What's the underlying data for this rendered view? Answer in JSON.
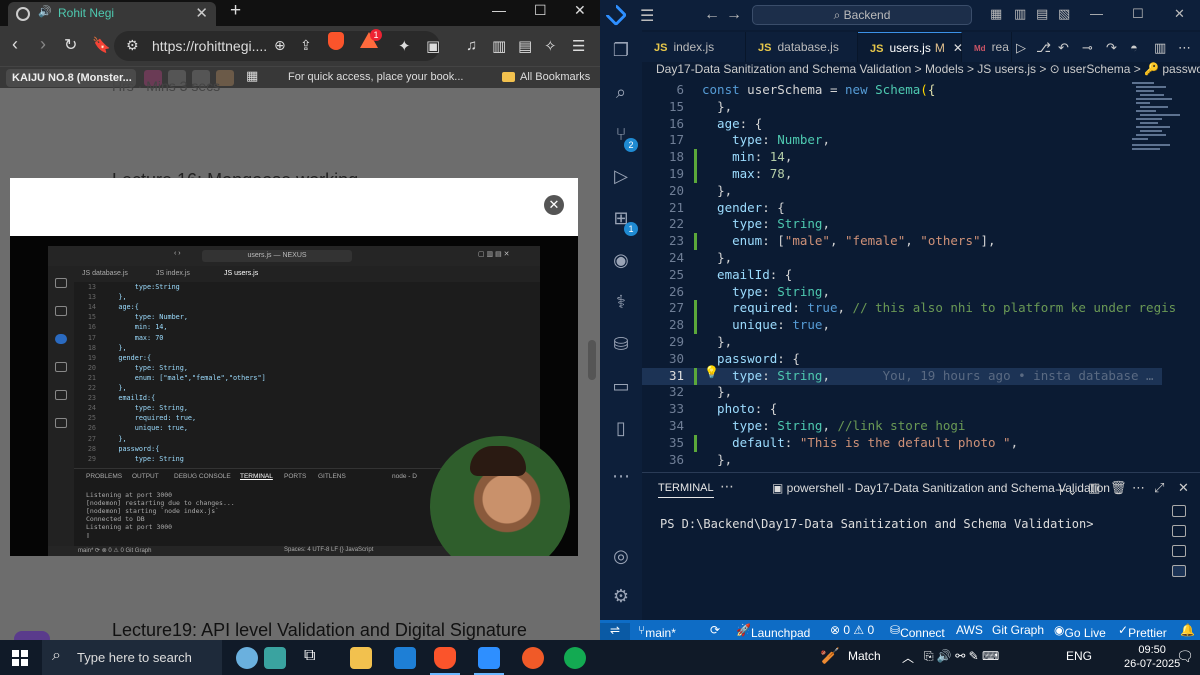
{
  "browser": {
    "tab_title": "Rohit Negi",
    "tab_close": "✕",
    "new_tab": "+",
    "url": "https://rohittnegi....",
    "brave_badge": "1",
    "bookmarks": {
      "first": "KAIJU NO.8 (Monster...",
      "hint": "For quick access, place your book...",
      "all": "All Bookmarks"
    },
    "page": {
      "top_partial": "Hrs · Mins 3 secs",
      "lecture16": "Lecture 16: Mongoose working",
      "lecture19": "Lecture19: API level Validation and Digital Signature",
      "modal_close": "✕"
    },
    "video": {
      "search": "users.js — NEXUS",
      "tabs": [
        "JS database.js",
        "JS index.js",
        "JS users.js"
      ],
      "code_lines": [
        {
          "n": "13",
          "t": "        type:String"
        },
        {
          "n": "13",
          "t": "    },"
        },
        {
          "n": "14",
          "t": "    age:{"
        },
        {
          "n": "15",
          "t": "        type: Number,"
        },
        {
          "n": "16",
          "t": "        min: 14,"
        },
        {
          "n": "17",
          "t": "        max: 70"
        },
        {
          "n": "18",
          "t": "    },"
        },
        {
          "n": "19",
          "t": "    gender:{"
        },
        {
          "n": "20",
          "t": "        type: String,"
        },
        {
          "n": "21",
          "t": "        enum: [\"male\",\"female\",\"others\"]"
        },
        {
          "n": "22",
          "t": "    },"
        },
        {
          "n": "23",
          "t": "    emailId:{"
        },
        {
          "n": "24",
          "t": "        type: String,"
        },
        {
          "n": "25",
          "t": "        required: true,"
        },
        {
          "n": "26",
          "t": "        unique: true,"
        },
        {
          "n": "27",
          "t": "    },"
        },
        {
          "n": "28",
          "t": "    password:{"
        },
        {
          "n": "29",
          "t": "        type: String"
        }
      ],
      "panel_tabs": [
        "PROBLEMS",
        "OUTPUT",
        "DEBUG CONSOLE",
        "TERMINAL",
        "PORTS",
        "GITLENS"
      ],
      "panel_node": "node - D",
      "terminal": "Listening at port 3000\n[nodemon] restarting due to changes...\n[nodemon] starting `node index.js`\nConnected to DB\nListening at port 3000\n▯",
      "status_left": "main*  ⟳  ⊗ 0 ⚠ 0  Git Graph",
      "status_right": "Spaces: 4   UTF-8   LF   {} JavaScript"
    }
  },
  "vscode": {
    "search": "Backend",
    "tabs": [
      {
        "label": "index.js",
        "type": "JS"
      },
      {
        "label": "database.js",
        "type": "JS"
      },
      {
        "label": "users.js",
        "type": "JS",
        "modified": "M",
        "close": "✕"
      },
      {
        "label": "rea",
        "type": "Md"
      }
    ],
    "breadcrumb": "Day17-Data Sanitization and Schema Validation  >  Models  >  JS  users.js  >  ⊙ userSchema  >  🔑 password",
    "code": [
      {
        "n": "6",
        "html": "<span class='k'>const</span> <span class='p'>userSchema</span> <span class='p'>=</span> <span class='k'>new</span> <span class='t'>Schema</span><span class='br'>(</span><span class='f'>{</span>"
      },
      {
        "n": "15",
        "html": "  <span class='p'>},</span>"
      },
      {
        "n": "16",
        "html": "  age<span class='p'>: {</span>"
      },
      {
        "n": "17",
        "html": "    type<span class='p'>:</span> <span class='t'>Number</span><span class='p'>,</span>"
      },
      {
        "n": "18",
        "html": "    min<span class='p'>:</span> <span class='n'>14</span><span class='p'>,</span>"
      },
      {
        "n": "19",
        "html": "    max<span class='p'>:</span> <span class='n'>78</span><span class='p'>,</span>"
      },
      {
        "n": "20",
        "html": "  <span class='p'>},</span>"
      },
      {
        "n": "21",
        "html": "  gender<span class='p'>: {</span>"
      },
      {
        "n": "22",
        "html": "    type<span class='p'>:</span> <span class='t'>String</span><span class='p'>,</span>"
      },
      {
        "n": "23",
        "html": "    enum<span class='p'>: [</span><span class='s'>\"male\"</span><span class='p'>,</span> <span class='s'>\"female\"</span><span class='p'>,</span> <span class='s'>\"others\"</span><span class='p'>],</span>"
      },
      {
        "n": "24",
        "html": "  <span class='p'>},</span>"
      },
      {
        "n": "25",
        "html": "  emailId<span class='p'>: {</span>"
      },
      {
        "n": "26",
        "html": "    type<span class='p'>:</span> <span class='t'>String</span><span class='p'>,</span>"
      },
      {
        "n": "27",
        "html": "    required<span class='p'>:</span> <span class='k'>true</span><span class='p'>,</span> <span class='c'>// this also nhi to platform ke under regis</span>"
      },
      {
        "n": "28",
        "html": "    unique<span class='p'>:</span> <span class='k'>true</span><span class='p'>,</span>"
      },
      {
        "n": "29",
        "html": "  <span class='p'>},</span>"
      },
      {
        "n": "30",
        "html": "  password<span class='p'>: {</span>"
      },
      {
        "n": "31",
        "html": "    type<span class='p'>:</span> <span class='t'>String</span><span class='p'>,</span>       <span class='blame'>You, 19 hours ago • insta database …</span>"
      },
      {
        "n": "32",
        "html": "  <span class='p'>},</span>"
      },
      {
        "n": "33",
        "html": "  photo<span class='p'>: {</span>"
      },
      {
        "n": "34",
        "html": "    type<span class='p'>:</span> <span class='t'>String</span><span class='p'>,</span> <span class='c'>//link store hogi</span>"
      },
      {
        "n": "35",
        "html": "    default<span class='p'>:</span> <span class='s'>\"This is the default photo \"</span><span class='p'>,</span>"
      },
      {
        "n": "36",
        "html": "  <span class='p'>},</span>"
      }
    ],
    "panel": {
      "title": "TERMINAL",
      "shell": "powershell - Day17-Data Sanitization and Schema Validation",
      "prompt": "PS D:\\Backend\\Day17-Data Sanitization and Schema Validation>"
    },
    "status": {
      "branch": "main*",
      "launchpad": "Launchpad",
      "problems": "⊗ 0 ⚠ 0",
      "connect": "Connect",
      "aws": "AWS",
      "gitgraph": "Git Graph",
      "golive": "Go Live",
      "prettier": "Prettier"
    },
    "badges": {
      "scm": "2",
      "ext": "1"
    }
  },
  "taskbar": {
    "search_placeholder": "Type here to search",
    "weather": "Match",
    "lang": "ENG",
    "time": "09:50",
    "date": "26-07-2025"
  },
  "colors": {
    "vscode_status": "#0e6cc5",
    "brave": "#fb542b"
  }
}
